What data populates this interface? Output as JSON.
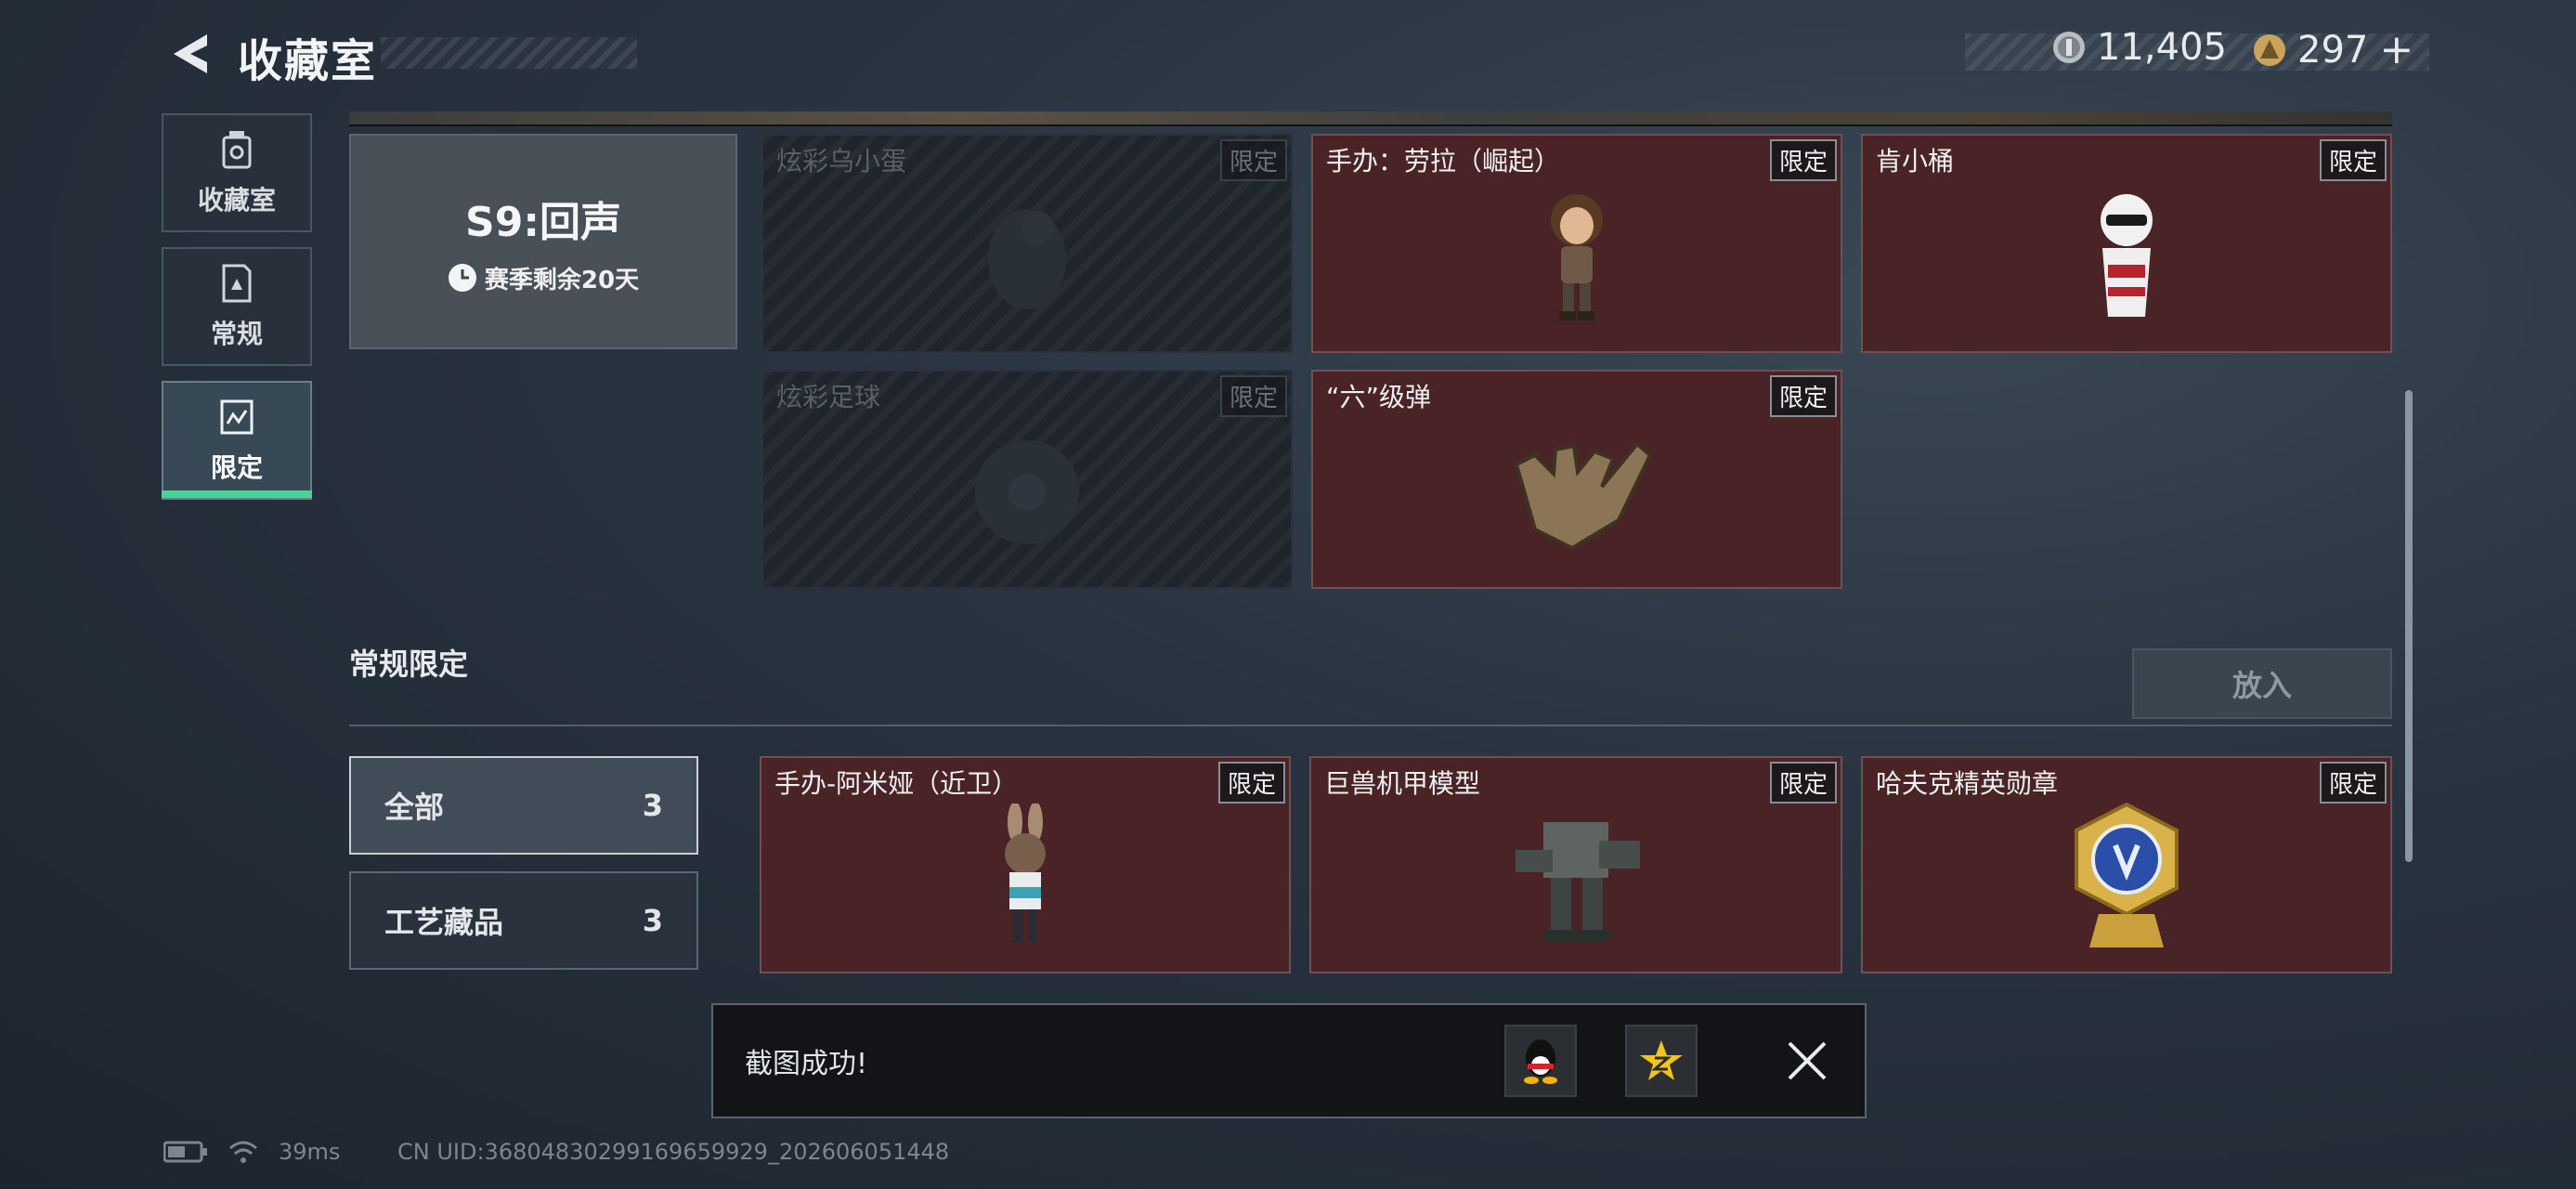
{
  "header": {
    "title": "收藏室",
    "currency_primary": "11,405",
    "currency_secondary": "297",
    "plus": "+"
  },
  "nav": {
    "items": [
      {
        "label": "收藏室",
        "icon": "trash-can-icon"
      },
      {
        "label": "常规",
        "icon": "document-icon"
      },
      {
        "label": "限定",
        "icon": "limited-icon"
      }
    ],
    "active": "限定"
  },
  "season": {
    "title": "S9:回声",
    "remaining": "赛季剩余20天"
  },
  "season_items": [
    {
      "name": "炫彩乌小蛋",
      "badge": "限定",
      "locked": true
    },
    {
      "name": "手办：劳拉（崛起）",
      "badge": "限定",
      "locked": false
    },
    {
      "name": "肯小桶",
      "badge": "限定",
      "locked": false
    },
    {
      "name": "炫彩足球",
      "badge": "限定",
      "locked": true
    },
    {
      "name": "“六”级弹",
      "badge": "限定",
      "locked": false
    }
  ],
  "section": {
    "title": "常规限定",
    "put_button": "放入"
  },
  "filters": [
    {
      "label": "全部",
      "count": "3"
    },
    {
      "label": "工艺藏品",
      "count": "3"
    }
  ],
  "regular_items": [
    {
      "name": "手办-阿米娅（近卫）",
      "badge": "限定"
    },
    {
      "name": "巨兽机甲模型",
      "badge": "限定"
    },
    {
      "name": "哈夫克精英勋章",
      "badge": "限定"
    }
  ],
  "toast": {
    "text": "截图成功!",
    "icons": [
      "qq-icon",
      "qzone-icon",
      "close-icon"
    ]
  },
  "status": {
    "ping": "39ms",
    "uid": "CN UID:3680483029916965992​9_202606051448"
  },
  "colors": {
    "accent_green": "#47d39a",
    "card_red": "#4a2327",
    "locked_bg": "#1f252c"
  }
}
